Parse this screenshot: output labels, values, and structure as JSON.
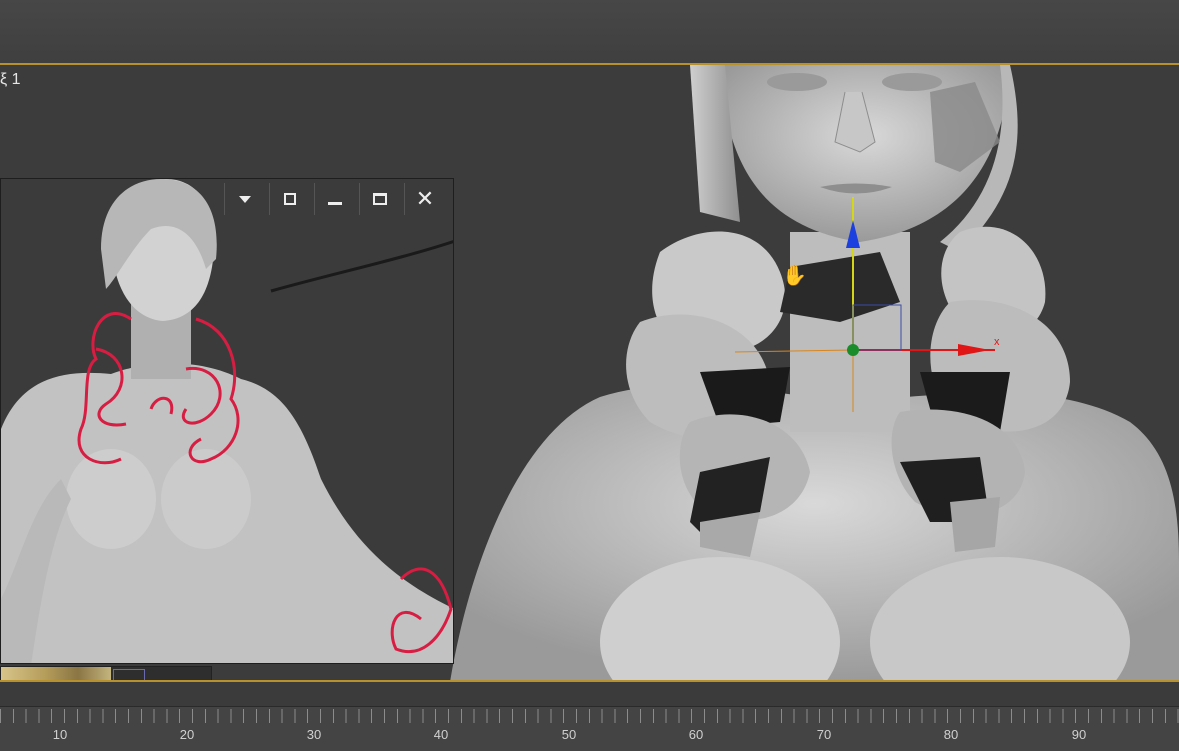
{
  "viewport": {
    "label": "ξ 1"
  },
  "float_window": {
    "controls": [
      "dropdown-icon",
      "maximize-viewport-icon",
      "minimize-icon",
      "restore-icon",
      "close-icon"
    ]
  },
  "timeline": {
    "ticks": [
      "10",
      "20",
      "30",
      "40",
      "50",
      "60",
      "70",
      "80",
      "90"
    ]
  },
  "colors": {
    "accent_border": "#b8902c",
    "sketch_red": "#d81d43",
    "gizmo_x": "#e01515",
    "gizmo_y": "#d6d619",
    "gizmo_z": "#1c3fe0"
  }
}
